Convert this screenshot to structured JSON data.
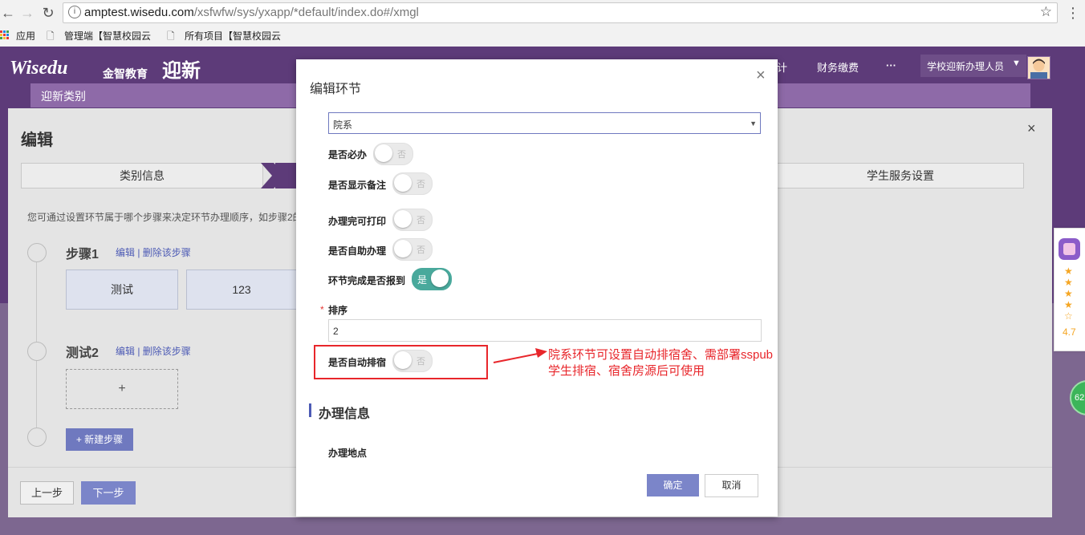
{
  "browser": {
    "url_host": "amptest.wisedu.com",
    "url_path": "/xsfwfw/sys/yxapp/*default/index.do#/xmgl",
    "bookmarks": [
      "应用",
      "管理端【智慧校园云",
      "所有项目【智慧校园云"
    ]
  },
  "app": {
    "logo_text": "Wisedu",
    "logo_cn": "金智教育",
    "app_name": "迎新",
    "nav_items": [
      "计",
      "财务缴费",
      "···"
    ],
    "user_role": "学校迎新办理人员",
    "subnav": "迎新类别"
  },
  "panel": {
    "title": "编辑",
    "tabs": [
      "类别信息",
      "学生服务设置"
    ],
    "hint": "您可通过设置环节属于哪个步骤来决定环节办理顺序，如步骤2的",
    "steps": [
      {
        "name": "步骤1",
        "actions": "编辑 | 删除该步骤",
        "cards": [
          "测试",
          "123"
        ]
      },
      {
        "name": "测试2",
        "actions": "编辑 | 删除该步骤",
        "cards": [
          "+"
        ]
      }
    ],
    "new_step": "+ 新建步骤",
    "prev": "上一步",
    "next": "下一步"
  },
  "modal": {
    "title": "编辑环节",
    "select_value": "院系",
    "fields": [
      {
        "label": "是否必办",
        "state": "否",
        "on": false
      },
      {
        "label": "是否显示备注",
        "state": "否",
        "on": false
      },
      {
        "label": "办理完可打印",
        "state": "否",
        "on": false
      },
      {
        "label": "是否自助办理",
        "state": "否",
        "on": false
      },
      {
        "label": "环节完成是否报到",
        "state": "是",
        "on": true
      }
    ],
    "order_label": "排序",
    "order_required": "*",
    "order_value": "2",
    "auto_dorm_label": "是否自动排宿",
    "auto_dorm_state": "否",
    "section_title": "办理信息",
    "location_label": "办理地点",
    "confirm": "确定",
    "cancel": "取消"
  },
  "annotation": {
    "line1": "院系环节可设置自动排宿舍、需部署sspub",
    "line2": "学生排宿、宿舍房源后可使用"
  },
  "side_widget": {
    "stars": "★★★★☆",
    "rating": "4.7",
    "badge": "62"
  },
  "colors": {
    "header_purple": "#5d3b79",
    "toggle_on": "#49a99c",
    "primary_button": "#7b85c9",
    "annotation_red": "#e8262b"
  }
}
